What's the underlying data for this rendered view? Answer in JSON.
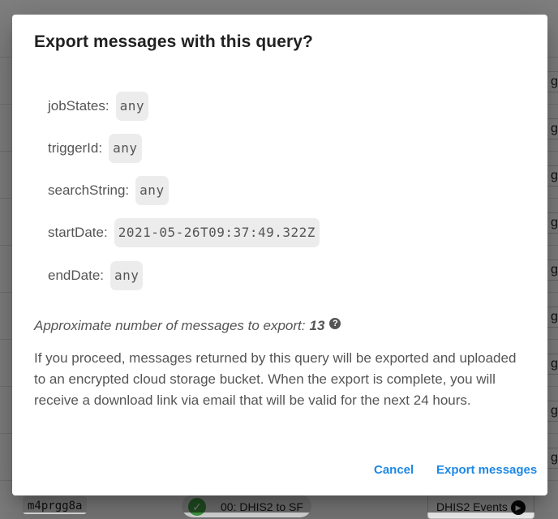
{
  "background": {
    "row_letter": "g",
    "bottom_row": {
      "id": "m4prgg8a",
      "status_check": "✓",
      "job_name": "00: DHIS2 to SF",
      "trigger": "DHIS2 Events"
    }
  },
  "dialog": {
    "title": "Export messages with this query?",
    "params": [
      {
        "label": "jobStates:",
        "value": "any"
      },
      {
        "label": "triggerId:",
        "value": "any"
      },
      {
        "label": "searchString:",
        "value": "any"
      },
      {
        "label": "startDate:",
        "value": "2021-05-26T09:37:49.322Z"
      },
      {
        "label": "endDate:",
        "value": "any"
      }
    ],
    "approx_label": "Approximate number of messages to export:",
    "approx_count": "13",
    "help_icon": "?",
    "description": "If you proceed, messages returned by this query will be exported and uploaded to an encrypted cloud storage bucket. When the export is complete, you will receive a download link via email that will be valid for the next 24 hours.",
    "cancel_label": "Cancel",
    "export_label": "Export messages",
    "accent_color": "#1e88e5"
  }
}
